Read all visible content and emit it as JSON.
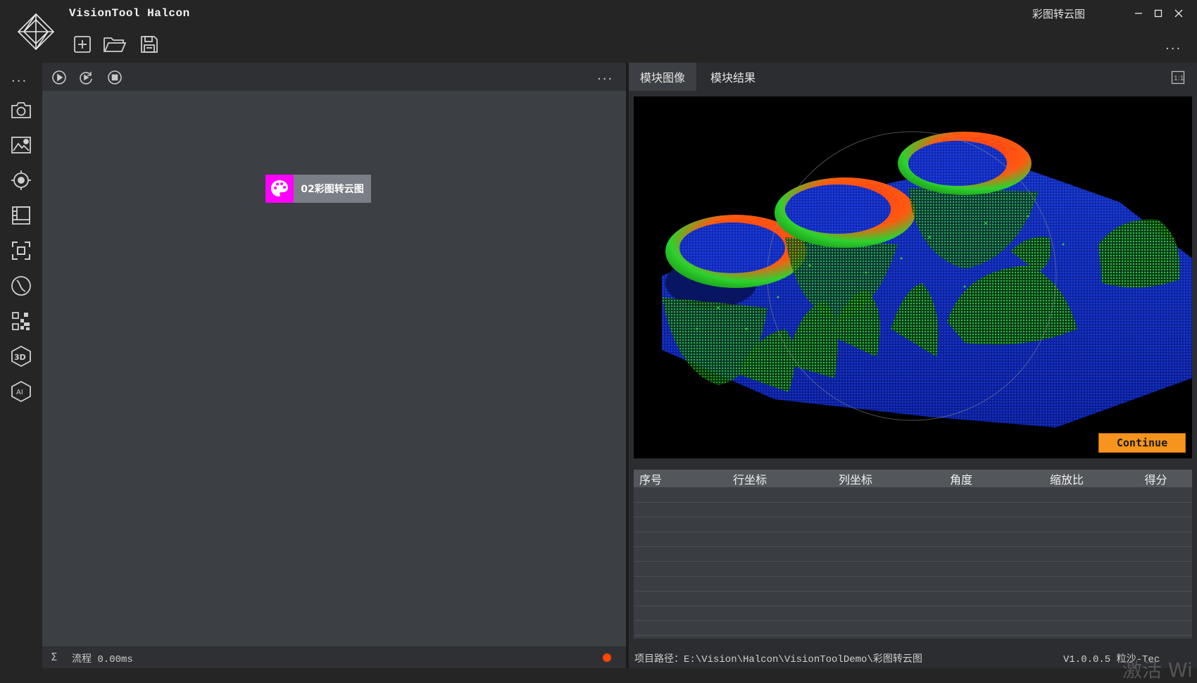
{
  "app": {
    "title": "VisionTool Halcon",
    "window_title": "彩图转云图"
  },
  "toolbar": {
    "new_icon": "new-file-icon",
    "open_icon": "folder-open-icon",
    "save_icon": "save-icon",
    "more": "..."
  },
  "leftbar": {
    "more": "...",
    "items": [
      {
        "icon": "camera-icon"
      },
      {
        "icon": "image-settings-icon"
      },
      {
        "icon": "target-icon"
      },
      {
        "icon": "panel-layout-icon"
      },
      {
        "icon": "focus-frame-icon"
      },
      {
        "icon": "curve-measure-icon"
      },
      {
        "icon": "qr-pattern-icon"
      },
      {
        "icon": "3d-icon"
      },
      {
        "icon": "ai-icon"
      }
    ]
  },
  "flow": {
    "more": "...",
    "node_label": "02彩图转云图",
    "status_sigma": "Σ",
    "status_text": "流程 0.00ms",
    "status_color": "#ff4500"
  },
  "tabs": [
    {
      "label": "模块图像",
      "active": true
    },
    {
      "label": "模块结果",
      "active": false
    }
  ],
  "viewer": {
    "continue_label": "Continue",
    "accent": "#f7941d"
  },
  "results_table": {
    "columns": [
      "序号",
      "行坐标",
      "列坐标",
      "角度",
      "缩放比",
      "得分"
    ],
    "rows": []
  },
  "status_bar": {
    "project_path": "项目路径：E:\\Vision\\Halcon\\VisionToolDemo\\彩图转云图",
    "version": "V1.0.0.5 粒沙-Tec",
    "watermark": "激活 Wi"
  }
}
